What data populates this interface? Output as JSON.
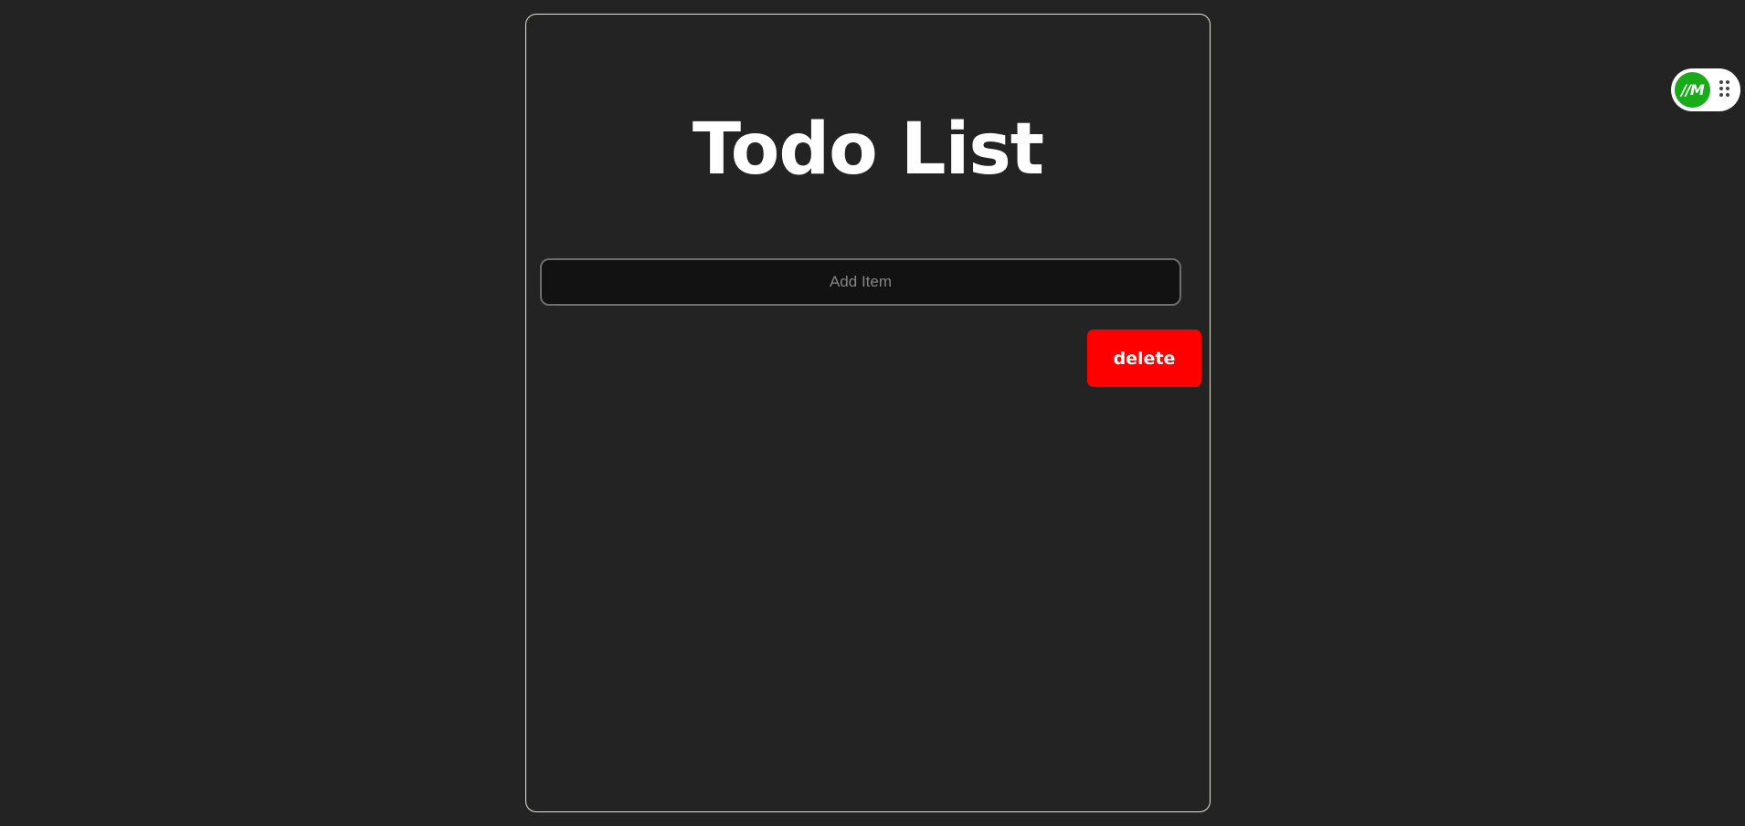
{
  "app": {
    "title": "Todo List"
  },
  "add_item": {
    "placeholder": "Add Item",
    "value": ""
  },
  "actions": {
    "delete_label": "delete"
  },
  "extension_widget": {
    "logo_text": "//M",
    "logo_color": "#1aab1a",
    "drag_icon": "drag-handle-icon"
  },
  "colors": {
    "background": "#232323",
    "card_border": "#e6e6d2",
    "delete_button": "#ff0000",
    "input_background": "#121212"
  }
}
